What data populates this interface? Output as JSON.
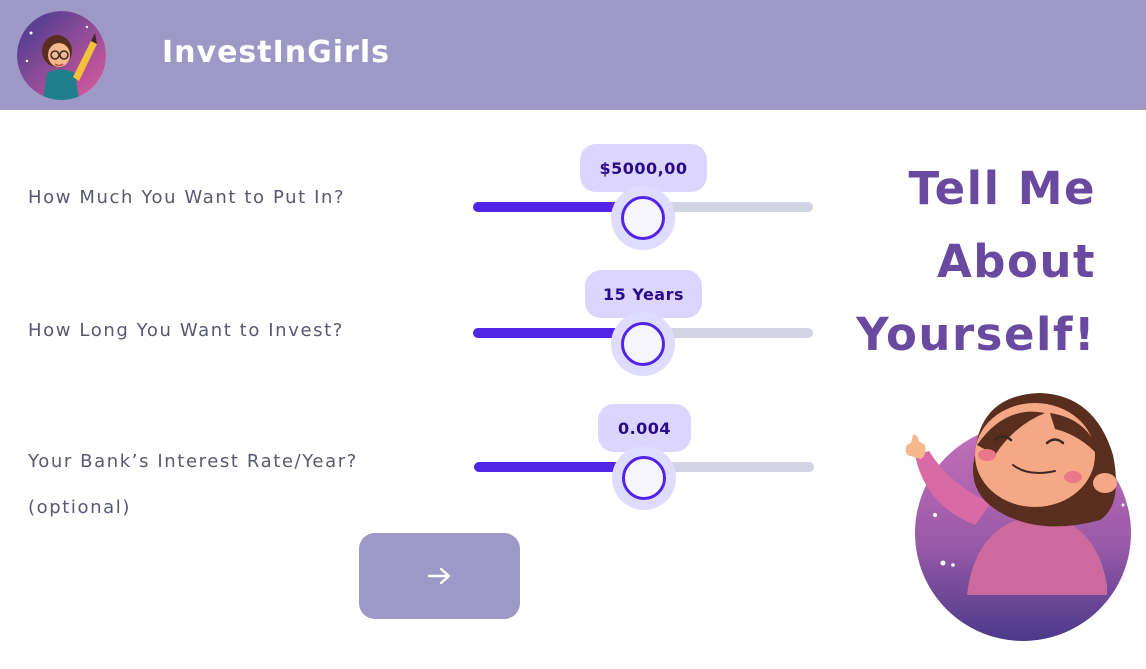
{
  "header": {
    "brand": "InvestInGirls",
    "logo_icon": "girl-with-pencil-avatar",
    "background": "#9d98c6"
  },
  "form": {
    "amount": {
      "label": "How Much You Want to Put In?",
      "value": "$5000,00",
      "level": 0.5
    },
    "duration": {
      "label": "How Long You Want to Invest?",
      "value": "15 Years",
      "level": 0.5
    },
    "interest": {
      "label": "Your Bank’s Interest Rate/Year?",
      "sublabel": "(optional)",
      "value": "0.004",
      "level": 0.5
    },
    "next_icon": "arrow-right-icon"
  },
  "headline": {
    "line1": "Tell Me",
    "line2": "About",
    "line3": "Yourself!"
  },
  "colors": {
    "accent": "#5125e8",
    "headline": "#6a4aa0",
    "bubble": "#dcd6ff"
  }
}
